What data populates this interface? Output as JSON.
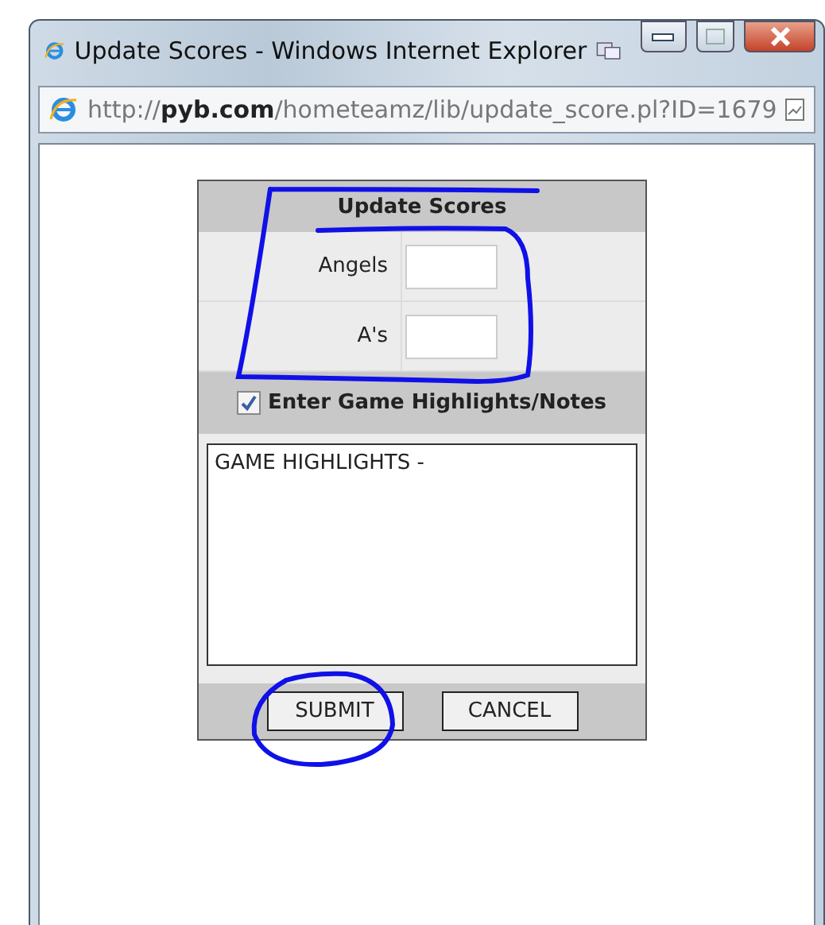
{
  "window": {
    "title": "Update Scores - Windows Internet Explorer"
  },
  "address_bar": {
    "url": "http://**pyb.com**/hometeamz/lib/update_score.pl?ID=1679"
  },
  "form": {
    "title": "Update Scores",
    "teams": [
      {
        "label": "Angels"
      },
      {
        "label": "A's"
      }
    ],
    "highlights_option": {
      "label": "Enter Game Highlights/Notes",
      "checked": true
    },
    "notes": {
      "value": "GAME HIGHLIGHTS -"
    },
    "buttons": [
      {
        "label": "SUBMIT"
      },
      {
        "label": "CANCEL"
      }
    ]
  }
}
